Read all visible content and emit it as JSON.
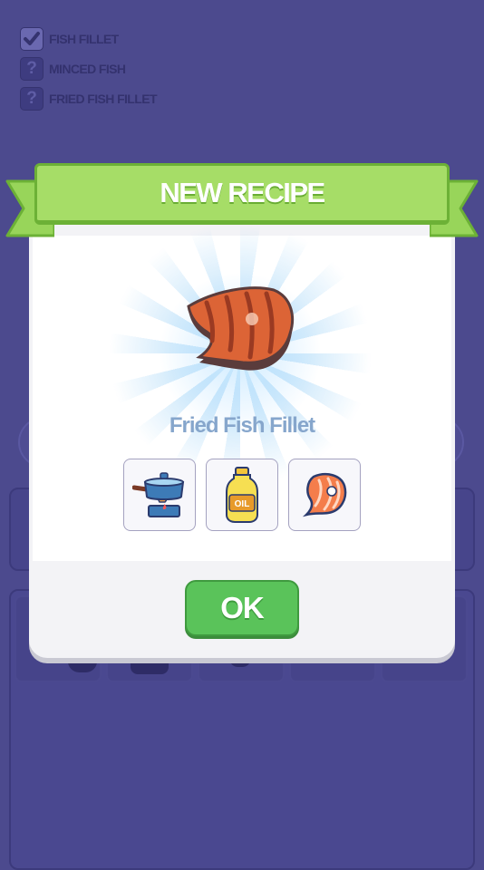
{
  "checklist": {
    "items": [
      {
        "label": "FISH FILLET",
        "state": "checked",
        "icon": "check-icon"
      },
      {
        "label": "MINCED FISH",
        "state": "unknown",
        "icon": "question-icon",
        "mark": "?"
      },
      {
        "label": "FRIED FISH FILLET",
        "state": "unknown",
        "icon": "question-icon",
        "mark": "?"
      }
    ]
  },
  "modal": {
    "title": "NEW RECIPE",
    "dish": {
      "name": "Fried Fish Fillet",
      "icon": "fried-fish-fillet-icon"
    },
    "ingredients": [
      {
        "name": "frying-pan-on-stove",
        "icon": "frying-pan-icon"
      },
      {
        "name": "oil-bottle",
        "icon": "oil-bottle-icon",
        "text": "OIL"
      },
      {
        "name": "fish-fillet",
        "icon": "fish-fillet-icon"
      }
    ],
    "ok_label": "OK"
  },
  "colors": {
    "background": "#4c4a8e",
    "banner": "#a6dd67",
    "ok_button": "#5ac35a",
    "dish_name": "#86a6cc"
  }
}
